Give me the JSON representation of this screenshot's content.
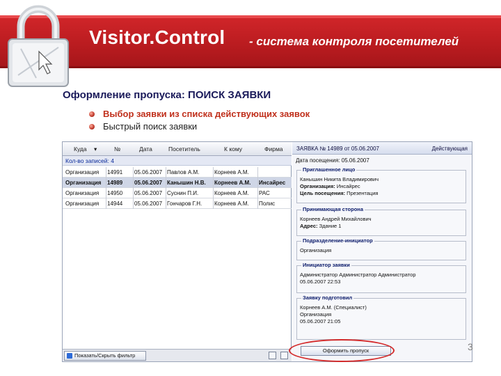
{
  "banner": {
    "title": "Visitor.Control",
    "subtitle": "- система контроля посетителей",
    "colors": {
      "banner": "#c0201f",
      "text": "#ffffff"
    }
  },
  "logo": {
    "icon": "padlock-icon"
  },
  "heading": "Оформление пропуска: ПОИСК ЗАЯВКИ",
  "bullets": [
    "Выбор заявки из списка действующих заявок",
    "Быстрый поиск заявки"
  ],
  "app": {
    "grid": {
      "columns": [
        "Куда",
        "№",
        "Дата",
        "Посетитель",
        "К кому",
        "Фирма"
      ],
      "count_label": "Кол-во записей: 4",
      "rows": [
        [
          "Организация",
          "14991",
          "05.06.2007",
          "Павлов А.М.",
          "Корнеев А.М.",
          ""
        ],
        [
          "Организация",
          "14989",
          "05.06.2007",
          "Канышин Н.В.",
          "Корнеев А.М.",
          "Инсайрес"
        ],
        [
          "Организация",
          "14950",
          "05.06.2007",
          "Суснин П.И.",
          "Корнеев А.М.",
          "РАС"
        ],
        [
          "Организация",
          "14944",
          "05.06.2007",
          "Гончаров Г.Н.",
          "Корнеев А.М.",
          "Полис"
        ]
      ],
      "selected_row": 1,
      "filter_button": "Показать/Скрыть фильтр"
    },
    "detail": {
      "title": "ЗАЯВКА № 14989 от 05.06.2007",
      "status": "Действующая",
      "visit_date": "Дата посещения: 05.06.2007",
      "groups": [
        {
          "label": "Приглашенное лицо",
          "lines": [
            {
              "label": "",
              "value": "Канышин Никита Владимирович"
            },
            {
              "label": "Организация:",
              "value": "Инсайрес"
            },
            {
              "label": "Цель посещения:",
              "value": "Презентация"
            }
          ]
        },
        {
          "label": "Принимающая сторона",
          "lines": [
            {
              "label": "",
              "value": "Корнеев Андрей Михайлович"
            },
            {
              "label": "Адрес:",
              "value": "Здание 1"
            }
          ]
        },
        {
          "label": "Подразделение-инициатор",
          "lines": [
            {
              "label": "",
              "value": "Организация"
            }
          ]
        },
        {
          "label": "Инициатор заявки",
          "lines": [
            {
              "label": "",
              "value": "Администратор Администратор Администратор"
            },
            {
              "label": "",
              "value": "05.06.2007 22:53"
            }
          ]
        },
        {
          "label": "Заявку подготовил",
          "lines": [
            {
              "label": "",
              "value": "Корнеев А.М. (Специалист)"
            },
            {
              "label": "",
              "value": "Организация"
            },
            {
              "label": "",
              "value": "05.06.2007 21:05"
            }
          ]
        }
      ],
      "submit_button": "Оформить пропуск"
    }
  },
  "page_number": "3"
}
